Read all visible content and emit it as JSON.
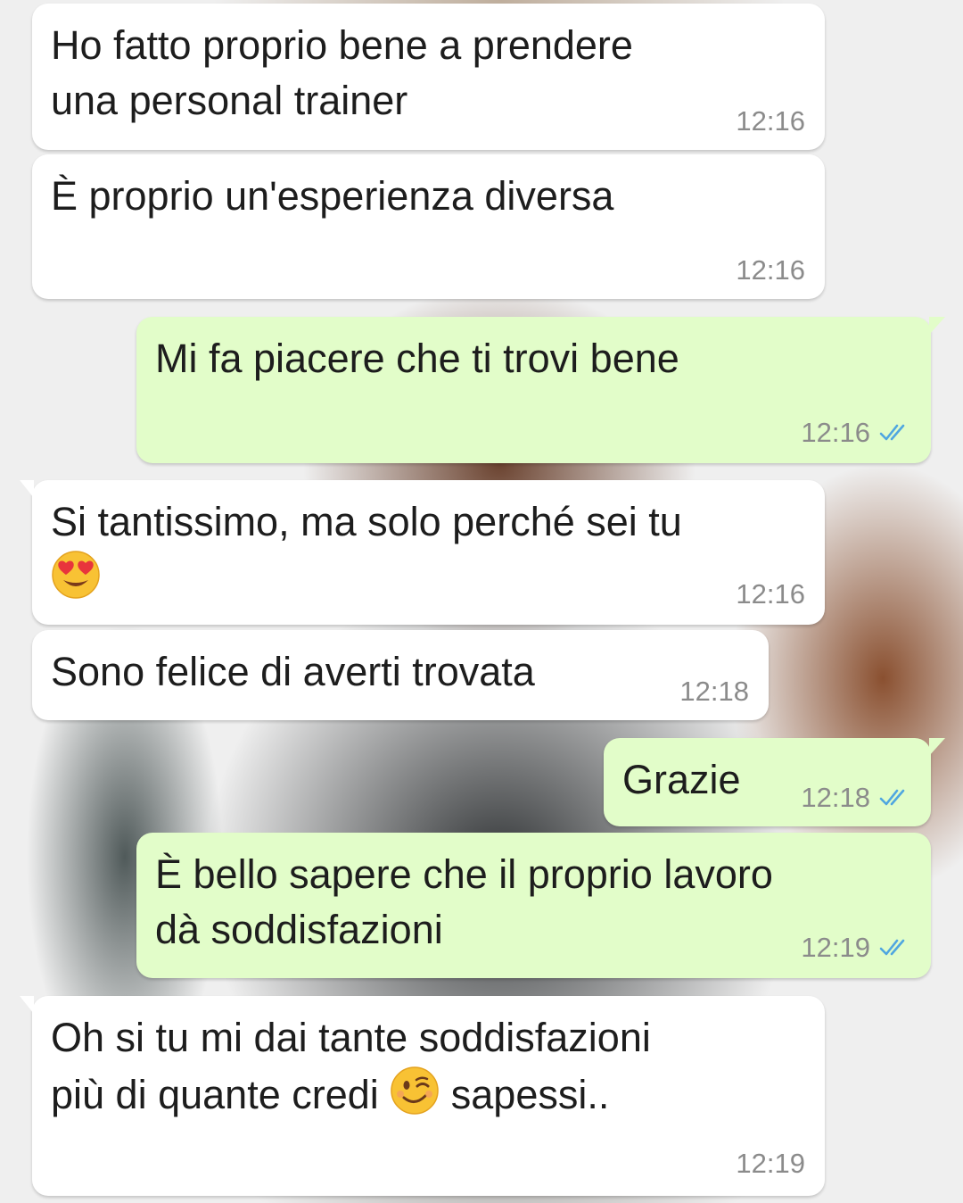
{
  "messages": [
    {
      "side": "in",
      "text": "Ho fatto proprio bene a prendere\nuna personal trainer",
      "time": "12:16"
    },
    {
      "side": "in",
      "text": "È proprio un'esperienza diversa",
      "time": "12:16"
    },
    {
      "side": "out",
      "text": "Mi fa piacere che ti trovi bene",
      "time": "12:16",
      "status": "read"
    },
    {
      "side": "in",
      "text_before": "Si tantissimo, ma solo perché sei tu\n",
      "emoji": "heart-eyes-emoji",
      "text_after": "",
      "time": "12:16"
    },
    {
      "side": "in",
      "text": "Sono felice di averti trovata",
      "time": "12:18"
    },
    {
      "side": "out",
      "text": "Grazie",
      "time": "12:18",
      "status": "read"
    },
    {
      "side": "out",
      "text": "È bello sapere che il proprio lavoro\ndà soddisfazioni",
      "time": "12:19",
      "status": "read"
    },
    {
      "side": "in",
      "text_before": "Oh si tu mi dai tante soddisfazioni\npiù di quante credi ",
      "emoji": "winking-face-emoji",
      "text_after": " sapessi..",
      "time": "12:19"
    }
  ],
  "colors": {
    "incoming_bubble": "#ffffff",
    "outgoing_bubble": "#e2fdc9",
    "timestamp": "#8b8b8b",
    "read_ticks": "#4fa6e0"
  }
}
